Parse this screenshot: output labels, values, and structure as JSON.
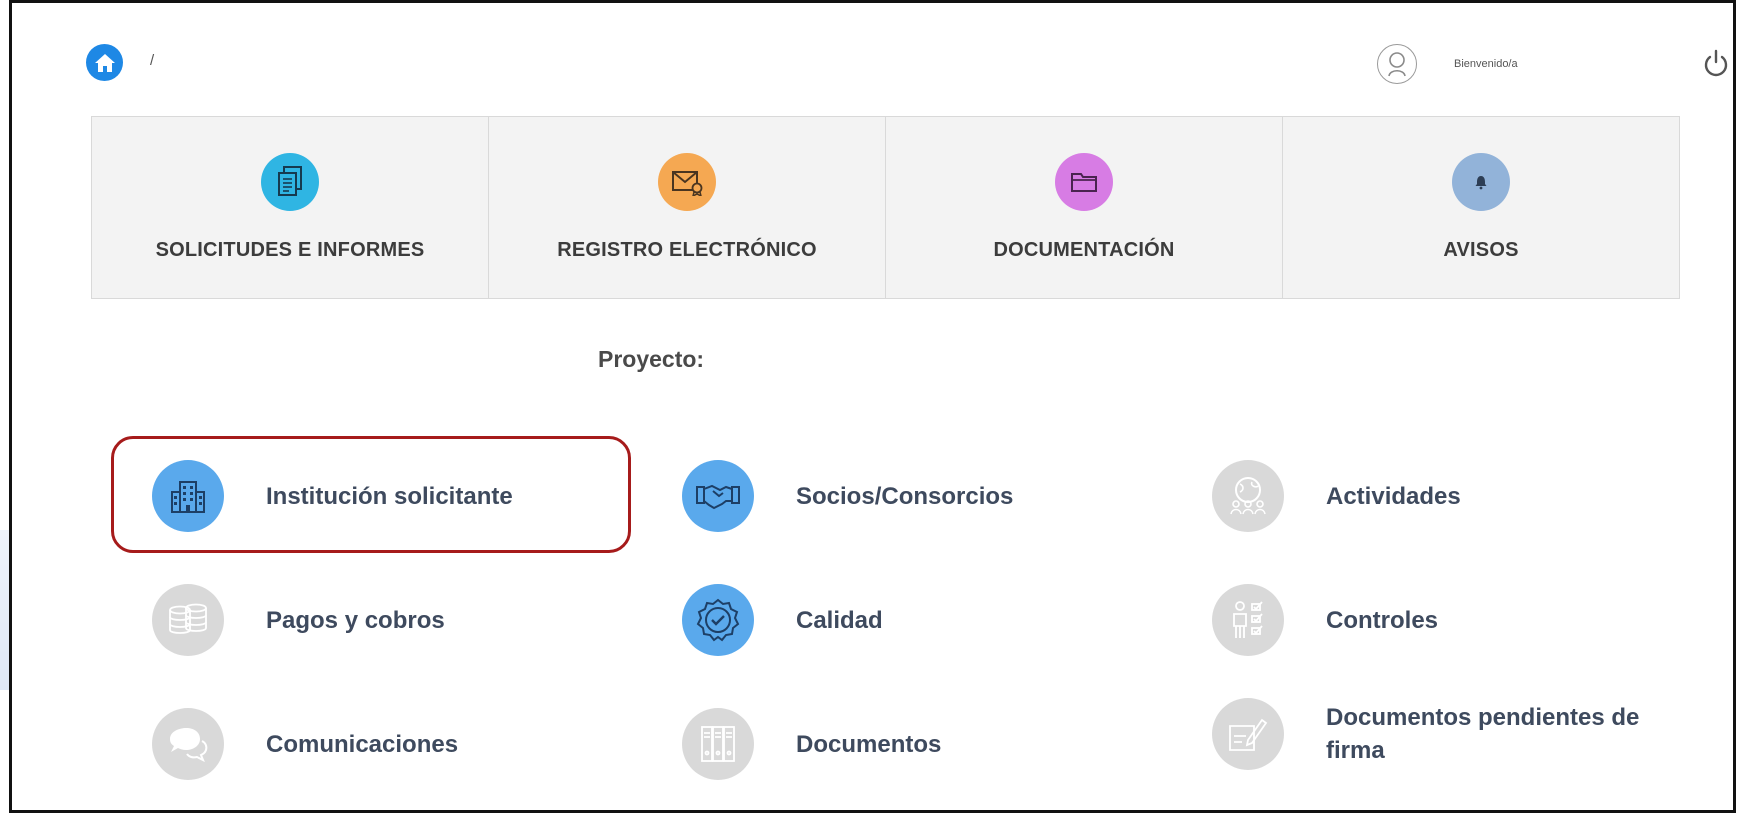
{
  "breadcrumb": {
    "separator": "/"
  },
  "header": {
    "welcome": "Bienvenido/a"
  },
  "tiles": [
    {
      "label": "SOLICITUDES E INFORMES",
      "color": "#2fb5e3",
      "icon": "documents-icon"
    },
    {
      "label": "REGISTRO ELECTRÓNICO",
      "color": "#f5a852",
      "icon": "certified-mail-icon"
    },
    {
      "label": "DOCUMENTACIÓN",
      "color": "#d77ce4",
      "icon": "folder-icon"
    },
    {
      "label": "AVISOS",
      "color": "#92b3d9",
      "icon": "bell-icon"
    }
  ],
  "project": {
    "label": "Proyecto:"
  },
  "modules": {
    "institucion": {
      "label": "Institución solicitante",
      "state": "active",
      "icon": "buildings-icon"
    },
    "socios": {
      "label": "Socios/Consorcios",
      "state": "active",
      "icon": "handshake-icon"
    },
    "actividades": {
      "label": "Actividades",
      "state": "inactive",
      "icon": "globe-people-icon"
    },
    "pagos": {
      "label": "Pagos y cobros",
      "state": "inactive",
      "icon": "coins-icon"
    },
    "calidad": {
      "label": "Calidad",
      "state": "active",
      "icon": "quality-badge-icon"
    },
    "controles": {
      "label": "Controles",
      "state": "inactive",
      "icon": "checklist-person-icon"
    },
    "comunicaciones": {
      "label": "Comunicaciones",
      "state": "inactive",
      "icon": "chat-bubbles-icon"
    },
    "documentos": {
      "label": "Documentos",
      "state": "inactive",
      "icon": "binders-icon"
    },
    "pendientes": {
      "label": "Documentos pendientes de firma",
      "state": "inactive",
      "icon": "sign-document-icon"
    }
  },
  "colors": {
    "active_module": "#5aa9ec",
    "inactive_module": "#d9d9d9",
    "highlight_border": "#a61b1b",
    "home": "#1e88e5"
  }
}
